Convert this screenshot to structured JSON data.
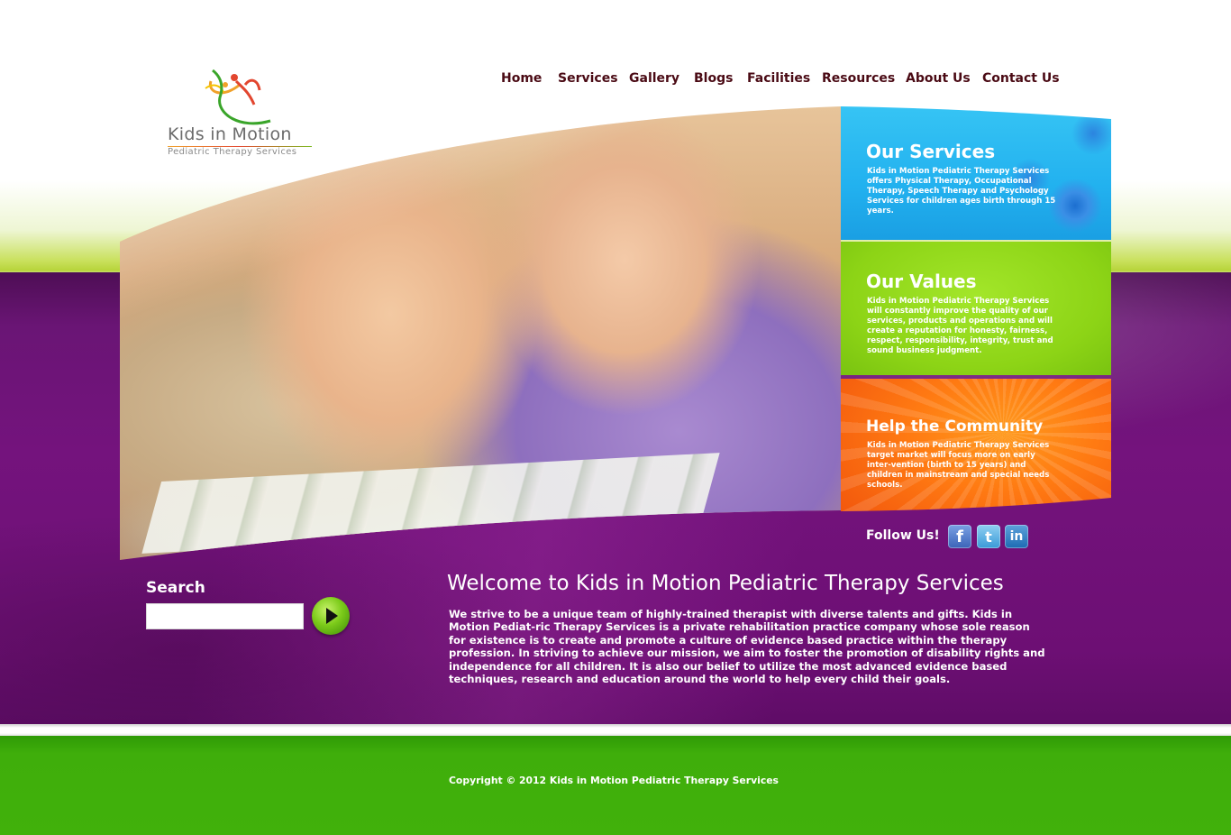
{
  "logo": {
    "title": "Kids in Motion",
    "subtitle": "Pediatric Therapy Services"
  },
  "nav": {
    "items": [
      "Home",
      "Services",
      "Gallery",
      "Blogs",
      "Facilities",
      "Resources",
      "About Us",
      "Contact Us"
    ]
  },
  "panels": {
    "services": {
      "title": "Our Services",
      "text": "Kids in Motion Pediatric Therapy Services offers Physical Therapy, Occupational Therapy, Speech Therapy and Psychology Services for children ages birth through 15 years."
    },
    "values": {
      "title": "Our Values",
      "text": "Kids in Motion Pediatric Therapy Services will constantly improve the quality of our services, products and operations and will create a reputation for honesty, fairness, respect, responsibility, integrity, trust and sound business judgment."
    },
    "community": {
      "title": "Help the Community",
      "text": "Kids in Motion Pediatric Therapy Services target market will focus more on early inter-vention (birth to 15 years) and children in mainstream and special needs schools."
    }
  },
  "social": {
    "label": "Follow Us!",
    "facebook_glyph": "f",
    "twitter_glyph": "t",
    "linkedin_glyph": "in"
  },
  "search": {
    "label": "Search",
    "value": "",
    "placeholder": ""
  },
  "welcome": {
    "title": "Welcome to Kids in Motion Pediatric Therapy Services",
    "text": "We strive to be a unique team of highly-trained therapist with diverse talents and gifts. Kids in Motion Pediat-ric Therapy Services is a private rehabilitation practice company whose sole reason for existence is to create and promote a culture of evidence based practice within the therapy profession. In striving to achieve our mission, we aim to foster the promotion of disability rights and independence for all children. It is also our belief to utilize the most advanced evidence based techniques, research and education around the world to help every child their goals."
  },
  "footer": {
    "copyright": "Copyright © 2012 Kids in Motion Pediatric Therapy Services"
  },
  "colors": {
    "nav_text": "#4a0a14",
    "purple": "#74137d",
    "green": "#41b10b",
    "services_blue": "#22b1ef",
    "values_green": "#8dd416",
    "community_orange": "#ff7a12"
  }
}
